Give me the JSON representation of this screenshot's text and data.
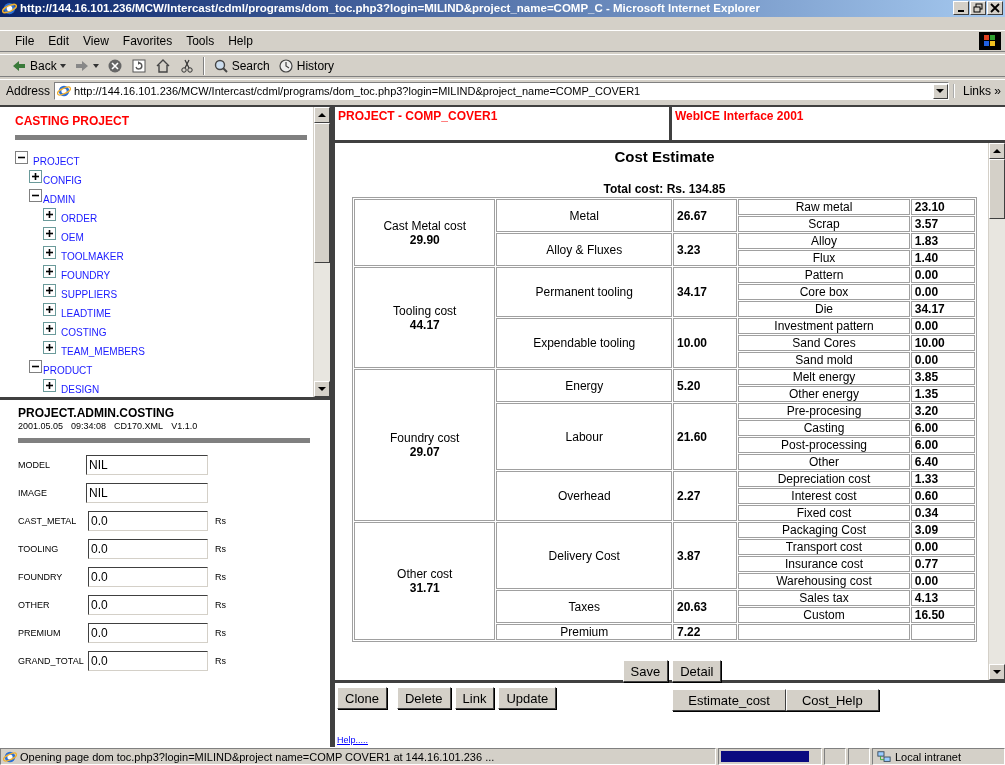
{
  "window": {
    "title": "http://144.16.101.236/MCW/Intercast/cdml/programs/dom_toc.php3?login=MILIND&project_name=COMP_C - Microsoft Internet Explorer"
  },
  "menu": [
    "File",
    "Edit",
    "View",
    "Favorites",
    "Tools",
    "Help"
  ],
  "toolbar": [
    {
      "kind": "back",
      "label": "Back"
    },
    {
      "kind": "forward"
    },
    {
      "kind": "stop"
    },
    {
      "kind": "refresh"
    },
    {
      "kind": "home"
    },
    {
      "kind": "cut"
    },
    {
      "kind": "search",
      "label": "Search"
    },
    {
      "kind": "history",
      "label": "History"
    }
  ],
  "address_bar": {
    "label": "Address",
    "url": "http://144.16.101.236/MCW/Intercast/cdml/programs/dom_toc.php3?login=MILIND&project_name=COMP_COVER1",
    "links": "Links",
    "more": "»"
  },
  "tree_panel": {
    "title": "CASTING PROJECT",
    "tree": [
      {
        "label": "PROJECT",
        "expanded": true,
        "children": [
          {
            "label": "CONFIG",
            "expanded": false
          },
          {
            "label": "ADMIN",
            "expanded": true,
            "children": [
              {
                "label": "ORDER",
                "expanded": false
              },
              {
                "label": "OEM",
                "expanded": false
              },
              {
                "label": "TOOLMAKER",
                "expanded": false
              },
              {
                "label": "FOUNDRY",
                "expanded": false
              },
              {
                "label": "SUPPLIERS",
                "expanded": false
              },
              {
                "label": "LEADTIME",
                "expanded": false
              },
              {
                "label": "COSTING",
                "expanded": false
              },
              {
                "label": "TEAM_MEMBERS",
                "expanded": false
              }
            ]
          },
          {
            "label": "PRODUCT",
            "expanded": true,
            "children": [
              {
                "label": "DESIGN",
                "expanded": false
              }
            ]
          }
        ]
      }
    ]
  },
  "details_panel": {
    "path": "PROJECT.ADMIN.COSTING",
    "meta": [
      "2001.05.05",
      "09:34:08",
      "CD170.XML",
      "V1.1.0"
    ],
    "fields": [
      {
        "label": "MODEL",
        "value": "NIL"
      },
      {
        "label": "IMAGE",
        "value": "NIL"
      },
      {
        "label": "CAST_METAL",
        "value": "0.0",
        "unit": "Rs"
      },
      {
        "label": "TOOLING",
        "value": "0.0",
        "unit": "Rs"
      },
      {
        "label": "FOUNDRY",
        "value": "0.0",
        "unit": "Rs"
      },
      {
        "label": "OTHER",
        "value": "0.0",
        "unit": "Rs"
      },
      {
        "label": "PREMIUM",
        "value": "0.0",
        "unit": "Rs"
      },
      {
        "label": "GRAND_TOTAL",
        "value": "0.0",
        "unit": "Rs"
      }
    ]
  },
  "header": {
    "project": "PROJECT - COMP_COVER1",
    "app": "WebICE Interface 2001"
  },
  "cost_estimate": {
    "title": "Cost Estimate",
    "total": "Total cost: Rs. 134.85",
    "groups": [
      {
        "name": "Cast Metal cost",
        "total": "29.90",
        "parts": [
          {
            "name": "Metal",
            "value": "26.67",
            "items": [
              {
                "name": "Raw metal",
                "value": "23.10"
              },
              {
                "name": "Scrap",
                "value": "3.57"
              }
            ]
          },
          {
            "name": "Alloy & Fluxes",
            "value": "3.23",
            "items": [
              {
                "name": "Alloy",
                "value": "1.83"
              },
              {
                "name": "Flux",
                "value": "1.40"
              }
            ]
          }
        ]
      },
      {
        "name": "Tooling cost",
        "total": "44.17",
        "parts": [
          {
            "name": "Permanent tooling",
            "value": "34.17",
            "items": [
              {
                "name": "Pattern",
                "value": "0.00"
              },
              {
                "name": "Core box",
                "value": "0.00"
              },
              {
                "name": "Die",
                "value": "34.17"
              }
            ]
          },
          {
            "name": "Expendable tooling",
            "value": "10.00",
            "items": [
              {
                "name": "Investment pattern",
                "value": "0.00"
              },
              {
                "name": "Sand Cores",
                "value": "10.00"
              },
              {
                "name": "Sand mold",
                "value": "0.00"
              }
            ]
          }
        ]
      },
      {
        "name": "Foundry cost",
        "total": "29.07",
        "parts": [
          {
            "name": "Energy",
            "value": "5.20",
            "items": [
              {
                "name": "Melt energy",
                "value": "3.85"
              },
              {
                "name": "Other energy",
                "value": "1.35"
              }
            ]
          },
          {
            "name": "Labour",
            "value": "21.60",
            "items": [
              {
                "name": "Pre-procesing",
                "value": "3.20"
              },
              {
                "name": "Casting",
                "value": "6.00"
              },
              {
                "name": "Post-processing",
                "value": "6.00"
              },
              {
                "name": "Other",
                "value": "6.40"
              }
            ]
          },
          {
            "name": "Overhead",
            "value": "2.27",
            "items": [
              {
                "name": "Depreciation cost",
                "value": "1.33"
              },
              {
                "name": "Interest cost",
                "value": "0.60"
              },
              {
                "name": "Fixed cost",
                "value": "0.34"
              }
            ]
          }
        ]
      },
      {
        "name": "Other cost",
        "total": "31.71",
        "parts": [
          {
            "name": "Delivery Cost",
            "value": "3.87",
            "items": [
              {
                "name": "Packaging Cost",
                "value": "3.09"
              },
              {
                "name": "Transport cost",
                "value": "0.00"
              },
              {
                "name": "Insurance cost",
                "value": "0.77"
              },
              {
                "name": "Warehousing cost",
                "value": "0.00"
              }
            ]
          },
          {
            "name": "Taxes",
            "value": "20.63",
            "items": [
              {
                "name": "Sales tax",
                "value": "4.13"
              },
              {
                "name": "Custom",
                "value": "16.50"
              }
            ]
          },
          {
            "name": "Premium",
            "value": "7.22"
          }
        ]
      }
    ],
    "buttons": [
      "Save",
      "Detail"
    ]
  },
  "actions": {
    "left": [
      "Clone",
      "Delete",
      "Link",
      "Update"
    ],
    "right": [
      "Estimate_cost",
      "Cost_Help"
    ],
    "help_link": "Help....."
  },
  "status_bar": {
    "text": "Opening page dom toc.php3?login=MILIND&project name=COMP COVER1 at 144.16.101.236 ...",
    "progress": {
      "level": 0.9
    },
    "zone": "Local intranet"
  }
}
